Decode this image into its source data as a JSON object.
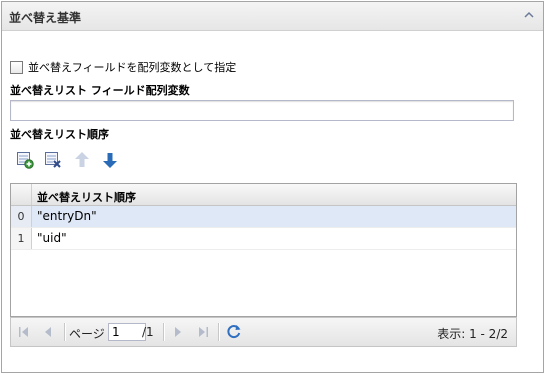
{
  "panel": {
    "title": "並べ替え基準"
  },
  "checkbox": {
    "label": "並べ替えフィールドを配列変数として指定",
    "checked": false
  },
  "field_array": {
    "label": "並べ替えリスト フィールド配列変数",
    "value": ""
  },
  "sort_order": {
    "label": "並べ替えリスト順序",
    "toolbar": [
      {
        "name": "add-row-icon",
        "enabled": true
      },
      {
        "name": "delete-row-icon",
        "enabled": true
      },
      {
        "name": "move-up-icon",
        "enabled": false
      },
      {
        "name": "move-down-icon",
        "enabled": true
      }
    ]
  },
  "grid": {
    "column_header": "並べ替えリスト順序",
    "rows": [
      {
        "index": "0",
        "value": "\"entryDn\""
      },
      {
        "index": "1",
        "value": "\"uid\""
      }
    ]
  },
  "pager": {
    "page_label": "ページ",
    "page_value": "1",
    "of_pages": "/1",
    "display": "表示: 1 - 2/2"
  },
  "colors": {
    "selected_row": "#dfe8f6",
    "arrow_blue": "#2a6bb8"
  }
}
